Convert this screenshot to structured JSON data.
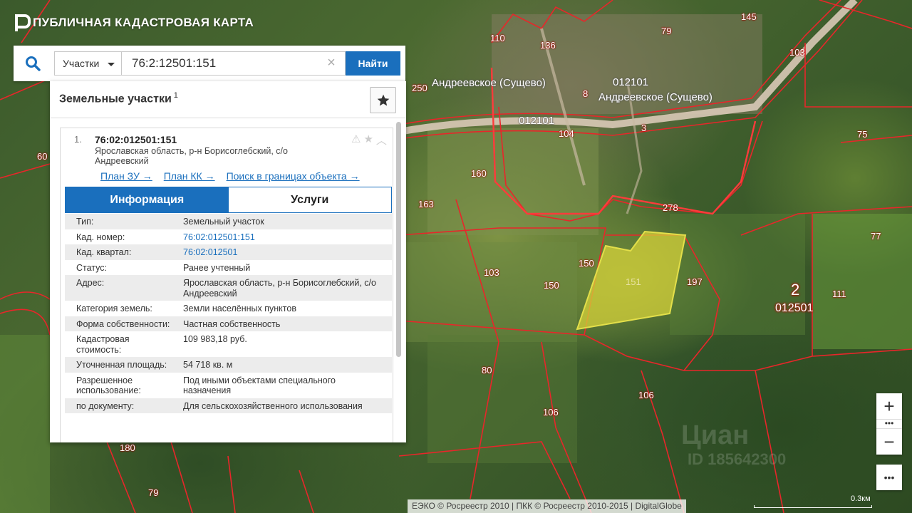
{
  "app": {
    "title": "ПУБЛИЧНАЯ КАДАСТРОВАЯ КАРТА"
  },
  "search": {
    "type_label": "Участки",
    "query": "76:2:12501:151",
    "clear_label": "×",
    "find_label": "Найти"
  },
  "panel": {
    "title": "Земельные участки",
    "count": "1",
    "result": {
      "index": "1.",
      "number": "76:02:012501:151",
      "address": "Ярославская область, р-н Борисоглебский, с/о Андреевский",
      "links": [
        "План ЗУ →",
        "План КК →",
        "Поиск в границах объекта →"
      ],
      "tabs": [
        "Информация",
        "Услуги"
      ],
      "info": [
        {
          "label": "Тип:",
          "value": "Земельный участок"
        },
        {
          "label": "Кад. номер:",
          "value": "76:02:012501:151"
        },
        {
          "label": "Кад. квартал:",
          "value": "76:02:012501"
        },
        {
          "label": "Статус:",
          "value": "Ранее учтенный"
        },
        {
          "label": "Адрес:",
          "value": "Ярославская область, р-н Борисоглебский, с/о Андреевский"
        },
        {
          "label": "Категория земель:",
          "value": "Земли населённых пунктов"
        },
        {
          "label": "Форма собственности:",
          "value": "Частная собственность"
        },
        {
          "label": "Кадастровая стоимость:",
          "value": "109 983,18 руб."
        },
        {
          "label": "Уточненная площадь:",
          "value": "54 718 кв. м"
        },
        {
          "label": "Разрешенное использование:",
          "value": "Под иными объектами специального назначения"
        },
        {
          "label": "по документу:",
          "value": "Для сельскохозяйственного использования"
        }
      ]
    }
  },
  "map": {
    "villages": [
      "Андреевское (Сущево)",
      "Андреевское (Сущево)"
    ],
    "quarter_codes": [
      "012101",
      "012101"
    ],
    "plot_numbers": [
      "110",
      "136",
      "79",
      "145",
      "103",
      "250",
      "8",
      "3",
      "104",
      "160",
      "163",
      "278",
      "75",
      "77",
      "103",
      "150",
      "150",
      "197",
      "111",
      "80",
      "106",
      "106",
      "180",
      "79",
      "60"
    ],
    "selected_plot": "151",
    "quarter_big": "2",
    "quarter_sub": "012501",
    "attribution": "ЕЭКО © Росреестр 2010 | ПКК © Росреестр 2010-2015 | DigitalGlobe",
    "scale": "0.3км",
    "watermark": "Циан",
    "watermark_id": "ID 185642300",
    "colors": {
      "boundary": "#e8262a",
      "selected_fill": "#d6d23a",
      "accent": "#1a6fbd"
    }
  },
  "controls": {
    "zoom_in": "+",
    "zoom_dots": "•••",
    "zoom_out": "−",
    "more": "•••"
  }
}
